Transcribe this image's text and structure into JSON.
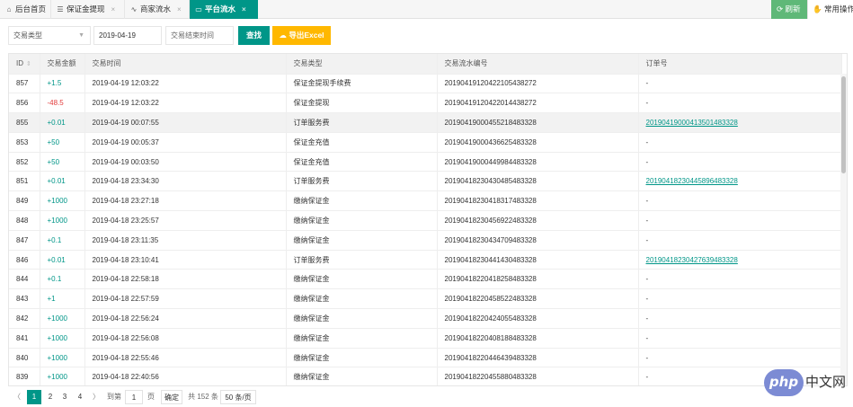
{
  "tabs": [
    {
      "icon": "⌂",
      "label": "后台首页",
      "close": ""
    },
    {
      "icon": "☰",
      "label": "保证金提现",
      "close": "×"
    },
    {
      "icon": "∿",
      "label": "商家流水",
      "close": "×"
    },
    {
      "icon": "▭",
      "label": "平台流水",
      "close": "×"
    }
  ],
  "toolbar": {
    "refresh_label": "⟳ 刷新",
    "common_label": "✋ 常用操作"
  },
  "filters": {
    "type_placeholder": "交易类型",
    "start_date": "2019-04-19",
    "end_placeholder": "交易结束时间",
    "query_label": "查找",
    "export_label": "☁ 导出Excel"
  },
  "table": {
    "columns": [
      "ID",
      "交易金额",
      "交易时间",
      "交易类型",
      "交易流水编号",
      "订单号"
    ],
    "rows": [
      {
        "id": "857",
        "amount": "+1.5",
        "time": "2019-04-19 12:03:22",
        "type": "保证金提现手续费",
        "serial": "20190419120422105438272",
        "order": "-"
      },
      {
        "id": "856",
        "amount": "-48.5",
        "time": "2019-04-19 12:03:22",
        "type": "保证金提现",
        "serial": "20190419120422014438272",
        "order": "-"
      },
      {
        "id": "855",
        "amount": "+0.01",
        "time": "2019-04-19 00:07:55",
        "type": "订单服务费",
        "serial": "2019041900045521848332​8",
        "order": "20190419000413501483328"
      },
      {
        "id": "853",
        "amount": "+50",
        "time": "2019-04-19 00:05:37",
        "type": "保证金充值",
        "serial": "20190419000436625483328",
        "order": "-"
      },
      {
        "id": "852",
        "amount": "+50",
        "time": "2019-04-19 00:03:50",
        "type": "保证金充值",
        "serial": "20190419000449984483328",
        "order": "-"
      },
      {
        "id": "851",
        "amount": "+0.01",
        "time": "2019-04-18 23:34:30",
        "type": "订单服务费",
        "serial": "20190418230430485483328",
        "order": "20190418230445896483328"
      },
      {
        "id": "849",
        "amount": "+1000",
        "time": "2019-04-18 23:27:18",
        "type": "缴纳保证金",
        "serial": "20190418230418317483328",
        "order": "-"
      },
      {
        "id": "848",
        "amount": "+1000",
        "time": "2019-04-18 23:25:57",
        "type": "缴纳保证金",
        "serial": "20190418230456922483328",
        "order": "-"
      },
      {
        "id": "847",
        "amount": "+0.1",
        "time": "2019-04-18 23:11:35",
        "type": "缴纳保证金",
        "serial": "20190418230434709483328",
        "order": "-"
      },
      {
        "id": "846",
        "amount": "+0.01",
        "time": "2019-04-18 23:10:41",
        "type": "订单服务费",
        "serial": "20190418230441430483328",
        "order": "20190418230427639483328"
      },
      {
        "id": "844",
        "amount": "+0.1",
        "time": "2019-04-18 22:58:18",
        "type": "缴纳保证金",
        "serial": "20190418220418258483328",
        "order": "-"
      },
      {
        "id": "843",
        "amount": "+1",
        "time": "2019-04-18 22:57:59",
        "type": "缴纳保证金",
        "serial": "20190418220458522483328",
        "order": "-"
      },
      {
        "id": "842",
        "amount": "+1000",
        "time": "2019-04-18 22:56:24",
        "type": "缴纳保证金",
        "serial": "20190418220424055483328",
        "order": "-"
      },
      {
        "id": "841",
        "amount": "+1000",
        "time": "2019-04-18 22:56:08",
        "type": "缴纳保证金",
        "serial": "20190418220408188483328",
        "order": "-"
      },
      {
        "id": "840",
        "amount": "+1000",
        "time": "2019-04-18 22:55:46",
        "type": "缴纳保证金",
        "serial": "20190418220446439483328",
        "order": "-"
      },
      {
        "id": "839",
        "amount": "+1000",
        "time": "2019-04-18 22:40:56",
        "type": "缴纳保证金",
        "serial": "20190418220455880483328",
        "order": "-"
      }
    ]
  },
  "pagination": {
    "prev": "〈",
    "pages": [
      "1",
      "2",
      "3",
      "4"
    ],
    "next": "〉",
    "goto_label": "到第",
    "goto_value": "1",
    "page_unit": "页",
    "confirm_label": "确定",
    "total_label": "共 152 条",
    "size_label": "50 条/页 ⇕"
  },
  "watermark": {
    "logo": "php",
    "text": "中文网"
  }
}
